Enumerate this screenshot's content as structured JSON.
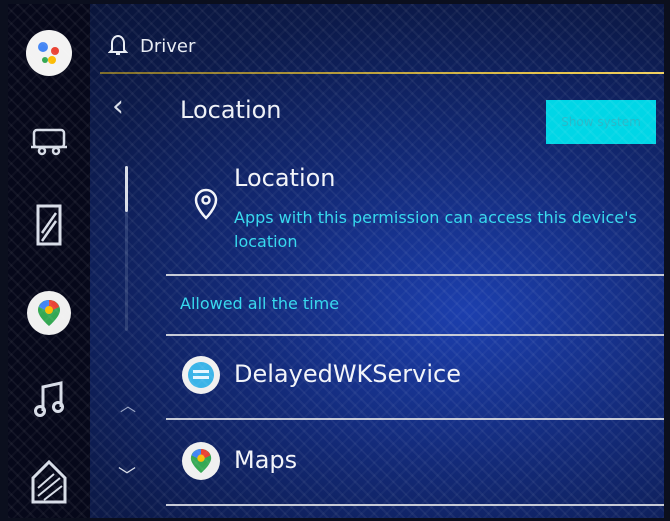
{
  "header": {
    "title": "Driver"
  },
  "page": {
    "title": "Location",
    "show_system_label": "Show system"
  },
  "permission": {
    "title": "Location",
    "description": "Apps with this permission can access this device's location"
  },
  "section": {
    "label": "Allowed all the time"
  },
  "apps": [
    {
      "name": "DelayedWKService",
      "icon": "globe-icon"
    },
    {
      "name": "Maps",
      "icon": "maps-icon"
    }
  ],
  "rail": [
    "assistant-icon",
    "trailer-icon",
    "window-icon",
    "maps-icon",
    "music-icon",
    "home-icon"
  ],
  "colors": {
    "accent": "#34d9ee",
    "button": "#00d6e6",
    "header_line": "#e6c44a"
  }
}
